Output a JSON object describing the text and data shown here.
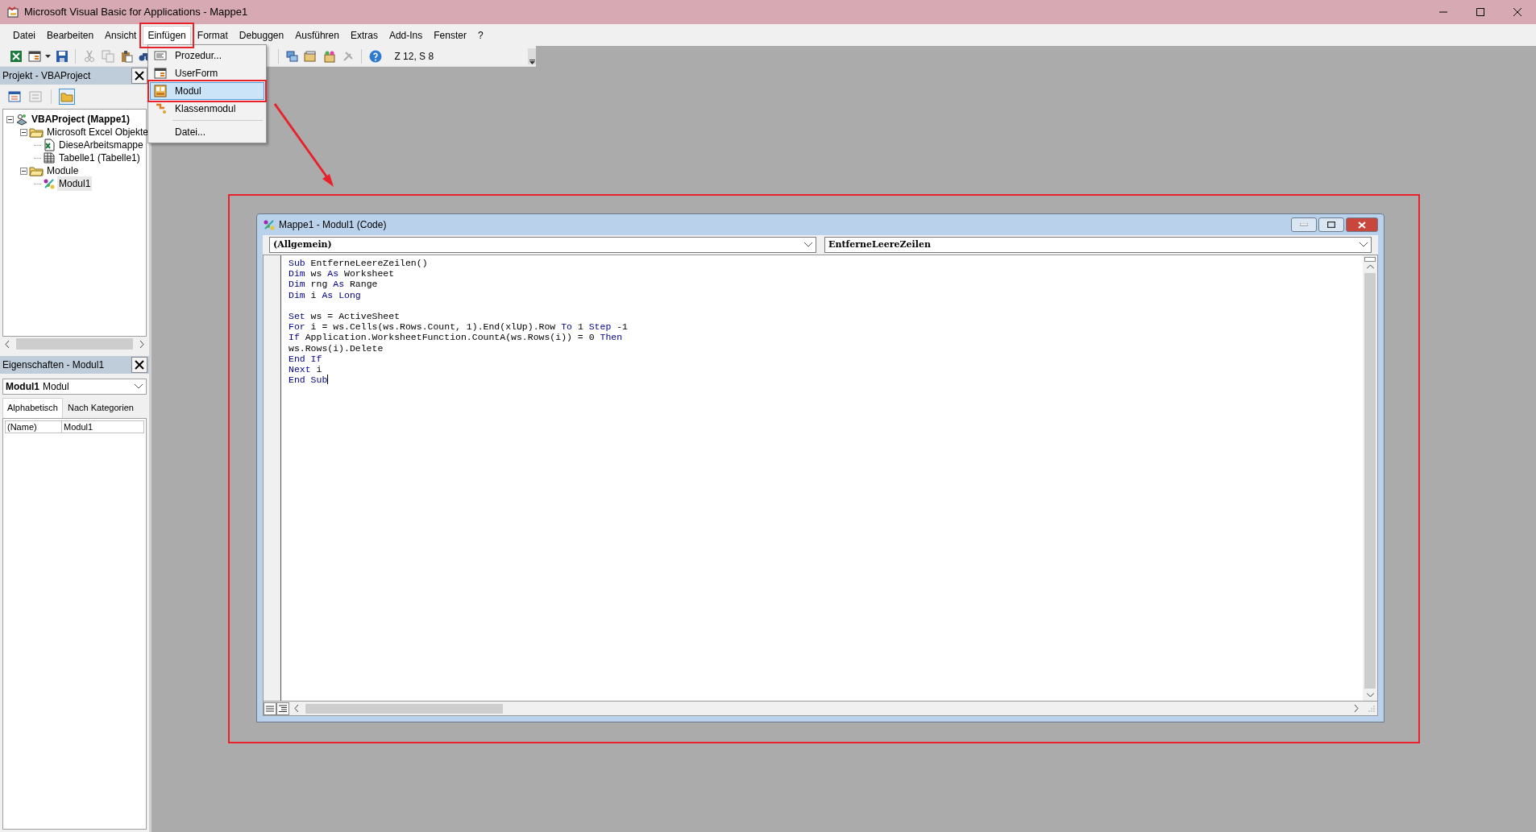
{
  "window": {
    "title": "Microsoft Visual Basic for Applications - Mappe1"
  },
  "menu_bar": [
    {
      "label": "Datei",
      "selected": false
    },
    {
      "label": "Bearbeiten",
      "selected": false
    },
    {
      "label": "Ansicht",
      "selected": false
    },
    {
      "label": "Einfügen",
      "selected": true
    },
    {
      "label": "Format",
      "selected": false
    },
    {
      "label": "Debuggen",
      "selected": false
    },
    {
      "label": "Ausführen",
      "selected": false
    },
    {
      "label": "Extras",
      "selected": false
    },
    {
      "label": "Add-Ins",
      "selected": false
    },
    {
      "label": "Fenster",
      "selected": false
    },
    {
      "label": "?",
      "selected": false
    }
  ],
  "insert_menu": [
    {
      "kind": "procedure",
      "label": "Prozedur...",
      "selected": false
    },
    {
      "kind": "form",
      "label": "UserForm",
      "selected": false
    },
    {
      "kind": "module",
      "label": "Modul",
      "selected": true
    },
    {
      "kind": "class",
      "label": "Klassenmodul",
      "selected": false
    },
    {
      "kind": "separator"
    },
    {
      "kind": "file",
      "label": "Datei...",
      "selected": false
    }
  ],
  "toolbar": {
    "position": "Z 12, S 8"
  },
  "project_panel": {
    "title": "Projekt - VBAProject",
    "tree": [
      {
        "label": "VBAProject (Mappe1)",
        "kind": "project",
        "bold": true,
        "expanded": true,
        "selected": false,
        "children": [
          {
            "label": "Microsoft Excel Objekte",
            "kind": "folder",
            "bold": false,
            "expanded": true,
            "selected": false,
            "children": [
              {
                "label": "DieseArbeitsmappe",
                "kind": "workbook",
                "bold": false,
                "selected": false
              },
              {
                "label": "Tabelle1 (Tabelle1)",
                "kind": "sheet",
                "bold": false,
                "selected": false
              }
            ]
          },
          {
            "label": "Module",
            "kind": "folder",
            "bold": false,
            "expanded": true,
            "selected": false,
            "children": [
              {
                "label": "Modul1",
                "kind": "module",
                "bold": false,
                "selected": true
              }
            ]
          }
        ]
      }
    ]
  },
  "properties_panel": {
    "title": "Eigenschaften - Modul1",
    "object": {
      "name": "Modul1",
      "type": "Modul"
    },
    "tabs": [
      {
        "label": "Alphabetisch",
        "selected": true
      },
      {
        "label": "Nach Kategorien",
        "selected": false
      }
    ],
    "rows": [
      {
        "name": "(Name)",
        "value": "Modul1"
      }
    ]
  },
  "code_window": {
    "title": "Mappe1 - Modul1 (Code)",
    "object_dropdown": "(Allgemein)",
    "procedure_dropdown": "EntferneLeereZeilen",
    "lines": [
      {
        "kind": "code",
        "tokens": [
          {
            "text": "Sub",
            "keyword": true
          },
          {
            "text": " EntferneLeereZeilen()",
            "keyword": false
          }
        ]
      },
      {
        "kind": "code",
        "tokens": [
          {
            "text": "Dim",
            "keyword": true
          },
          {
            "text": " ws ",
            "keyword": false
          },
          {
            "text": "As",
            "keyword": true
          },
          {
            "text": " Worksheet",
            "keyword": false
          }
        ]
      },
      {
        "kind": "code",
        "tokens": [
          {
            "text": "Dim",
            "keyword": true
          },
          {
            "text": " rng ",
            "keyword": false
          },
          {
            "text": "As",
            "keyword": true
          },
          {
            "text": " Range",
            "keyword": false
          }
        ]
      },
      {
        "kind": "code",
        "tokens": [
          {
            "text": "Dim",
            "keyword": true
          },
          {
            "text": " i ",
            "keyword": false
          },
          {
            "text": "As Long",
            "keyword": true
          }
        ]
      },
      {
        "kind": "blank"
      },
      {
        "kind": "code",
        "tokens": [
          {
            "text": "Set",
            "keyword": true
          },
          {
            "text": " ws = ActiveSheet",
            "keyword": false
          }
        ]
      },
      {
        "kind": "code",
        "tokens": [
          {
            "text": "For",
            "keyword": true
          },
          {
            "text": " i = ws.Cells(ws.Rows.Count, 1).End(xlUp).Row ",
            "keyword": false
          },
          {
            "text": "To",
            "keyword": true
          },
          {
            "text": " 1 ",
            "keyword": false
          },
          {
            "text": "Step",
            "keyword": true
          },
          {
            "text": " -1",
            "keyword": false
          }
        ]
      },
      {
        "kind": "code",
        "tokens": [
          {
            "text": "If",
            "keyword": true
          },
          {
            "text": " Application.WorksheetFunction.CountA(ws.Rows(i)) = 0 ",
            "keyword": false
          },
          {
            "text": "Then",
            "keyword": true
          }
        ]
      },
      {
        "kind": "code",
        "tokens": [
          {
            "text": "ws.Rows(i).Delete",
            "keyword": false
          }
        ]
      },
      {
        "kind": "code",
        "tokens": [
          {
            "text": "End If",
            "keyword": true
          }
        ]
      },
      {
        "kind": "code",
        "tokens": [
          {
            "text": "Next",
            "keyword": true
          },
          {
            "text": " i",
            "keyword": false
          }
        ]
      },
      {
        "kind": "code",
        "cursor": true,
        "tokens": [
          {
            "text": "End Sub",
            "keyword": true
          }
        ]
      }
    ]
  },
  "annotations": [
    {
      "kind": "menu-box",
      "color": "#e8212b"
    },
    {
      "kind": "entry-box",
      "color": "#e8212b"
    },
    {
      "kind": "arrow",
      "color": "#e8212b"
    },
    {
      "kind": "window-box",
      "color": "#e8212b"
    }
  ]
}
